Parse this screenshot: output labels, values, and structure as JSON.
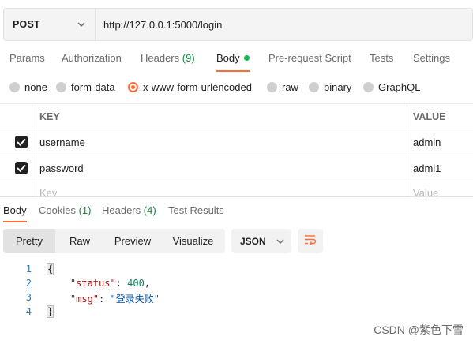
{
  "request": {
    "method": "POST",
    "url": "http://127.0.0.1:5000/login"
  },
  "request_tabs": [
    {
      "label": "Params"
    },
    {
      "label": "Authorization"
    },
    {
      "label": "Headers",
      "count": "(9)"
    },
    {
      "label": "Body",
      "active": true
    },
    {
      "label": "Pre-request Script"
    },
    {
      "label": "Tests"
    },
    {
      "label": "Settings"
    }
  ],
  "body_types": [
    {
      "label": "none"
    },
    {
      "label": "form-data"
    },
    {
      "label": "x-www-form-urlencoded",
      "selected": true
    },
    {
      "label": "raw"
    },
    {
      "label": "binary"
    },
    {
      "label": "GraphQL"
    }
  ],
  "params_table": {
    "headers": {
      "key": "KEY",
      "value": "VALUE"
    },
    "rows": [
      {
        "key": "username",
        "value": "admin",
        "checked": true
      },
      {
        "key": "password",
        "value": "admi1",
        "checked": true
      }
    ],
    "placeholder": {
      "key": "Key",
      "value": "Value"
    }
  },
  "response_tabs": [
    {
      "label": "Body",
      "active": true
    },
    {
      "label": "Cookies",
      "count": "(1)"
    },
    {
      "label": "Headers",
      "count": "(4)"
    },
    {
      "label": "Test Results"
    }
  ],
  "view_modes": [
    "Pretty",
    "Raw",
    "Preview",
    "Visualize"
  ],
  "active_view": "Pretty",
  "format": "JSON",
  "code": {
    "line_numbers": [
      "1",
      "2",
      "3",
      "4"
    ],
    "open_brace": "{",
    "close_brace": "}",
    "status_key": "\"status\"",
    "status_value": "400",
    "msg_key": "\"msg\"",
    "msg_value": "\"登录失败\""
  },
  "watermark": "CSDN @紫色下雪",
  "colors": {
    "accent": "#ff6c37",
    "active_dot": "#0fb84c",
    "count": "#0f8a41"
  }
}
